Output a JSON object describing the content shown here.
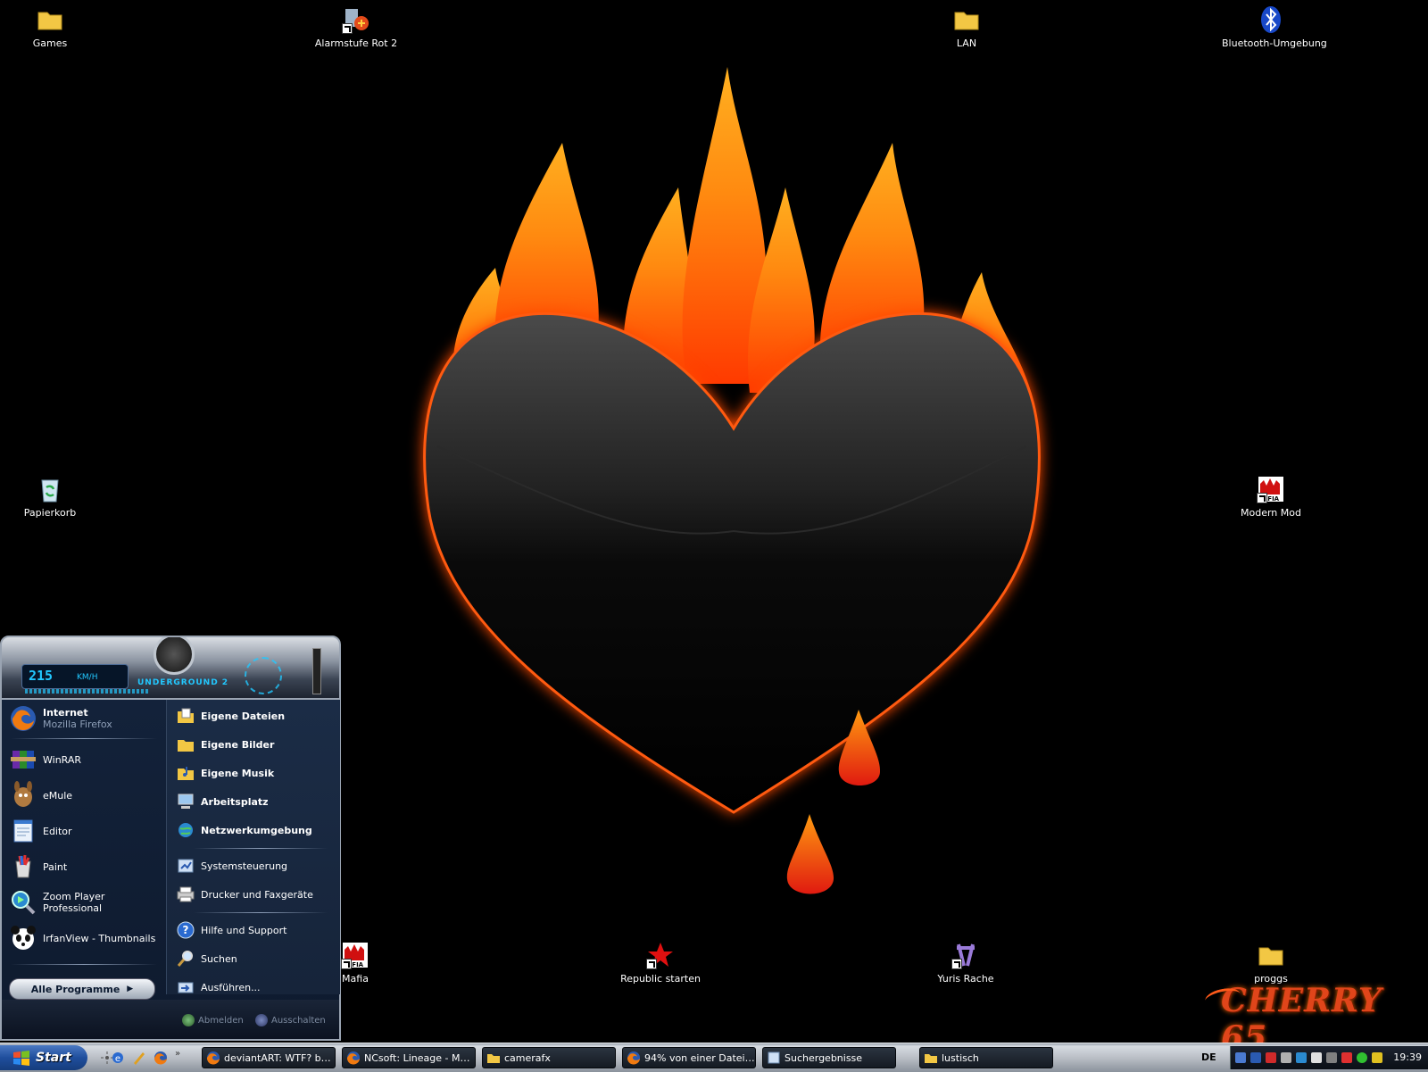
{
  "desktop": {
    "icons": [
      {
        "label": "Games"
      },
      {
        "label": "Alarmstufe Rot 2"
      },
      {
        "label": "LAN"
      },
      {
        "label": "Bluetooth-Umgebung"
      },
      {
        "label": "Papierkorb"
      },
      {
        "label": "Modern Mod"
      },
      {
        "label": "Mafia"
      },
      {
        "label": "Republic starten"
      },
      {
        "label": "Yuris Rache"
      },
      {
        "label": "proggs"
      }
    ],
    "brand": "CHERRY 65"
  },
  "start_menu": {
    "header": {
      "speed": "215",
      "speed_unit": "KM/H",
      "game": "UNDERGROUND 2"
    },
    "pinned": {
      "title": "Internet",
      "subtitle": "Mozilla Firefox"
    },
    "programs": [
      {
        "label": "WinRAR"
      },
      {
        "label": "eMule"
      },
      {
        "label": "Editor"
      },
      {
        "label": "Paint"
      },
      {
        "label": "Zoom Player Professional"
      },
      {
        "label": "IrfanView - Thumbnails"
      }
    ],
    "all_programs": "Alle Programme",
    "places": [
      {
        "label": "Eigene Dateien"
      },
      {
        "label": "Eigene Bilder"
      },
      {
        "label": "Eigene Musik"
      },
      {
        "label": "Arbeitsplatz"
      },
      {
        "label": "Netzwerkumgebung"
      }
    ],
    "settings": [
      {
        "label": "Systemsteuerung"
      },
      {
        "label": "Drucker und Faxgeräte"
      }
    ],
    "tools": [
      {
        "label": "Hilfe und Support"
      },
      {
        "label": "Suchen"
      },
      {
        "label": "Ausführen..."
      }
    ],
    "footer": {
      "logoff": "Abmelden",
      "shutdown": "Ausschalten"
    }
  },
  "taskbar": {
    "start": "Start",
    "tasks": [
      {
        "label": "deviantART: WTF? by ..."
      },
      {
        "label": "NCsoft: Lineage - Mozi..."
      },
      {
        "label": "camerafx"
      },
      {
        "label": "94% von einer Datei - ..."
      },
      {
        "label": "Suchergebnisse"
      },
      {
        "label": "lustisch"
      }
    ],
    "language": "DE",
    "clock": "19:39"
  },
  "colors": {
    "flame": "#ff7a00",
    "heart_glow": "#ff4a00",
    "taskbar_dark": "#141a22"
  }
}
